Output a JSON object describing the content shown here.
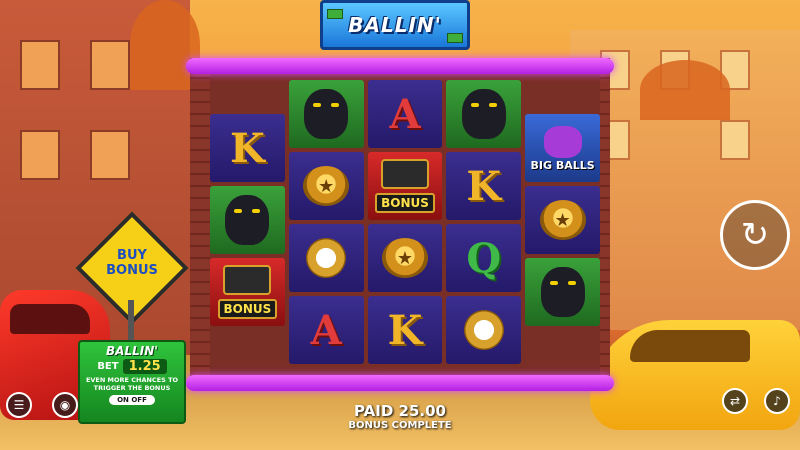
{
  "game": {
    "logo_text": "BALLIN'"
  },
  "reels": [
    [
      {
        "sym": "K"
      },
      {
        "sym": "panther"
      },
      {
        "sym": "bonus",
        "label": "BONUS"
      }
    ],
    [
      {
        "sym": "panther"
      },
      {
        "sym": "ring"
      },
      {
        "sym": "watch"
      },
      {
        "sym": "A"
      }
    ],
    [
      {
        "sym": "A"
      },
      {
        "sym": "bonus",
        "label": "BONUS"
      },
      {
        "sym": "ring"
      },
      {
        "sym": "K"
      }
    ],
    [
      {
        "sym": "panther"
      },
      {
        "sym": "K"
      },
      {
        "sym": "Q"
      },
      {
        "sym": "watch"
      }
    ],
    [
      {
        "sym": "bigballs",
        "label": "BIG BALLS"
      },
      {
        "sym": "ring"
      },
      {
        "sym": "panther"
      }
    ]
  ],
  "buy_bonus": {
    "line1": "BUY",
    "line2": "BONUS"
  },
  "feature_panel": {
    "title": "BALLIN'",
    "bet_label": "BET",
    "bet_value": "1.25",
    "description": "EVEN MORE CHANCES TO TRIGGER THE BONUS",
    "toggle_text": "ON OFF"
  },
  "status": {
    "paid_label": "PAID",
    "paid_value": "25.00",
    "message": "BONUS COMPLETE"
  },
  "icons": {
    "menu": "menu-icon",
    "bet": "coins-icon",
    "spin": "spin-icon",
    "autoplay": "autoplay-icon",
    "sound": "sound-icon"
  },
  "colors": {
    "neon": "#d74bff",
    "gold": "#f1b52a",
    "panel_green": "#2fc43c",
    "sign_yellow": "#f5d017"
  }
}
